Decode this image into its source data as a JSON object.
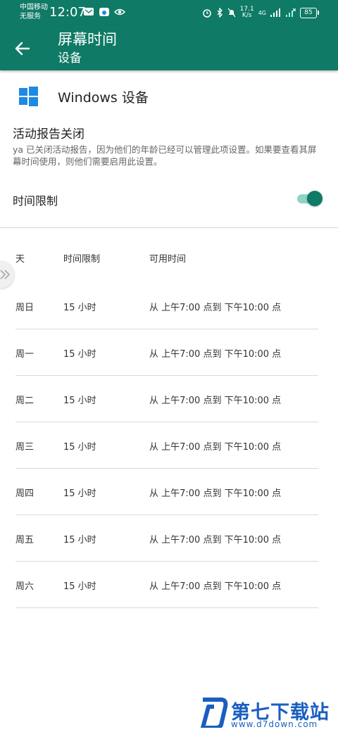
{
  "status_bar": {
    "carrier_line1": "中国移动",
    "carrier_line2": "无服务",
    "time": "12:07",
    "net_speed_value": "17.1",
    "net_speed_unit": "K/s",
    "network_type": "4G",
    "battery": "85"
  },
  "app_bar": {
    "title": "屏幕时间",
    "subtitle": "设备"
  },
  "device": {
    "name": "Windows 设备"
  },
  "report": {
    "title": "活动报告关闭",
    "description": "ya 已关闭活动报告，因为他们的年龄已经可以管理此项设置。如果要查看其屏幕时间使用，则他们需要启用此设置。"
  },
  "time_limit": {
    "label": "时间限制",
    "enabled": true
  },
  "schedule": {
    "headers": [
      "天",
      "时间限制",
      "可用时间"
    ],
    "rows": [
      {
        "day": "周日",
        "limit": "15 小时",
        "available": "从 上午7:00 点到 下午10:00 点"
      },
      {
        "day": "周一",
        "limit": "15 小时",
        "available": "从 上午7:00 点到 下午10:00 点"
      },
      {
        "day": "周二",
        "limit": "15 小时",
        "available": "从 上午7:00 点到 下午10:00 点"
      },
      {
        "day": "周三",
        "limit": "15 小时",
        "available": "从 上午7:00 点到 下午10:00 点"
      },
      {
        "day": "周四",
        "limit": "15 小时",
        "available": "从 上午7:00 点到 下午10:00 点"
      },
      {
        "day": "周五",
        "limit": "15 小时",
        "available": "从 上午7:00 点到 下午10:00 点"
      },
      {
        "day": "周六",
        "limit": "15 小时",
        "available": "从 上午7:00 点到 下午10:00 点"
      }
    ]
  },
  "watermark": {
    "text": "第七下载站",
    "url": "www.d7down.com"
  },
  "colors": {
    "primary": "#0f7a66",
    "toggle_track": "#8fd4c6",
    "windows_blue": "#1e88e5",
    "watermark_blue": "#1a5fc0"
  }
}
